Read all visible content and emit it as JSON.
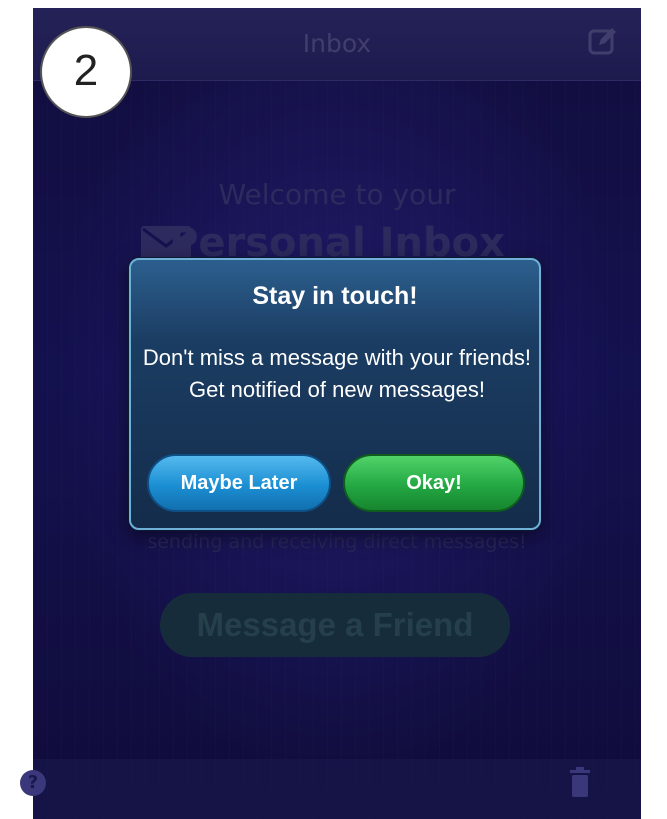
{
  "badge": {
    "number": "2"
  },
  "navbar": {
    "title": "Inbox"
  },
  "background": {
    "welcome_line": "Welcome to your",
    "heading": "Personal Inbox",
    "description": "sending and receiving direct messages!",
    "message_friend_button": "Message a Friend"
  },
  "toolbar": {
    "help_label": "?"
  },
  "modal": {
    "title": "Stay in touch!",
    "body": "Don't miss a message with your friends! Get notified of new messages!",
    "later_button": "Maybe Later",
    "okay_button": "Okay!"
  },
  "colors": {
    "modal_border": "#6fb0d9",
    "later_button": "#1b8fd3",
    "okay_button": "#23a843",
    "background": "#1d1870"
  },
  "icons": [
    "compose-icon",
    "envelope-icon",
    "help-icon",
    "trash-icon"
  ]
}
